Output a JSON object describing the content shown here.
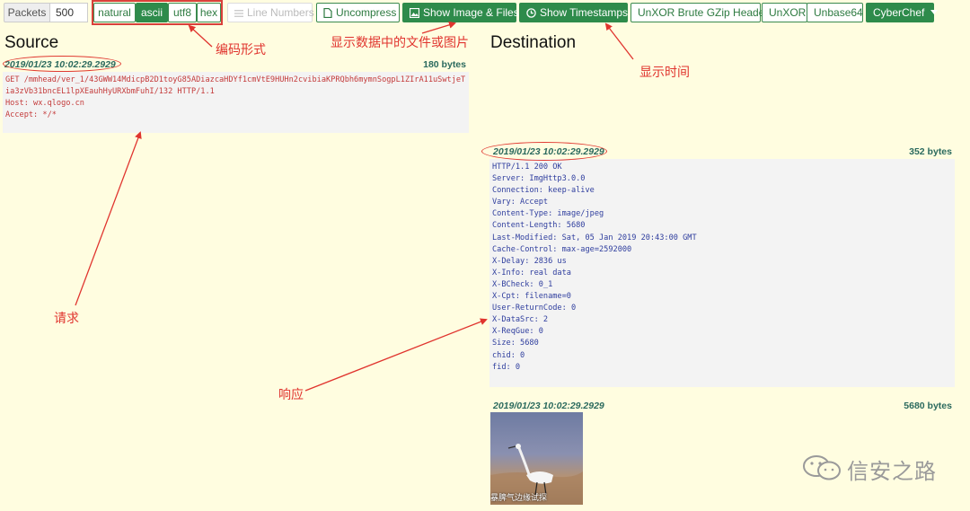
{
  "toolbar": {
    "packets_label": "Packets",
    "packets_value": "500",
    "encodings": [
      "natural",
      "ascii",
      "utf8",
      "hex"
    ],
    "selected_encoding": "ascii",
    "line_numbers": "Line Numbers",
    "uncompress": "Uncompress",
    "show_image_files": "Show Image & Files",
    "show_timestamps": "Show Timestamps",
    "unxor_brute": "UnXOR Brute GZip Header",
    "unxor": "UnXOR",
    "unbase64": "Unbase64",
    "cyberchef": "CyberChef"
  },
  "source": {
    "title": "Source",
    "timestamp": "2019/01/23 10:02:29.2929",
    "bytes": "180 bytes",
    "content": "GET /mmhead/ver_1/43GWW14MdicpB2D1toyG85ADiazcaHDYf1cmVtE9HUHn2cvibiaKPRQbh6mymnSogpL1ZIrA11uSwtjeTia3zVb31bncEL1lpXEauhHyURXbmFuhI/132 HTTP/1.1\nHost: wx.qlogo.cn\nAccept: */*"
  },
  "destination": {
    "title": "Destination",
    "timestamp": "2019/01/23 10:02:29.2929",
    "bytes": "352 bytes",
    "content": "HTTP/1.1 200 OK\nServer: ImgHttp3.0.0\nConnection: keep-alive\nVary: Accept\nContent-Type: image/jpeg\nContent-Length: 5680\nLast-Modified: Sat, 05 Jan 2019 20:43:00 GMT\nCache-Control: max-age=2592000\nX-Delay: 2836 us\nX-Info: real data\nX-BCheck: 0_1\nX-Cpt: filename=0\nUser-ReturnCode: 0\nX-DataSrc: 2\nX-ReqGue: 0\nSize: 5680\nchid: 0\nfid: 0",
    "image_timestamp": "2019/01/23 10:02:29.2929",
    "image_bytes": "5680 bytes",
    "image_caption": "暴脾气边缘试探"
  },
  "annotations": {
    "encoding": "编码形式",
    "files_images": "显示数据中的文件或图片",
    "time": "显示时间",
    "request": "请求",
    "response": "响应"
  },
  "watermark": "信安之路",
  "colors": {
    "background": "#fffde0",
    "accent_green": "#2e8b4b",
    "annotation_red": "#e0342e",
    "request_text": "#c43b3b",
    "response_text": "#2f3e9e",
    "timestamp_teal": "#2b6a5e"
  }
}
